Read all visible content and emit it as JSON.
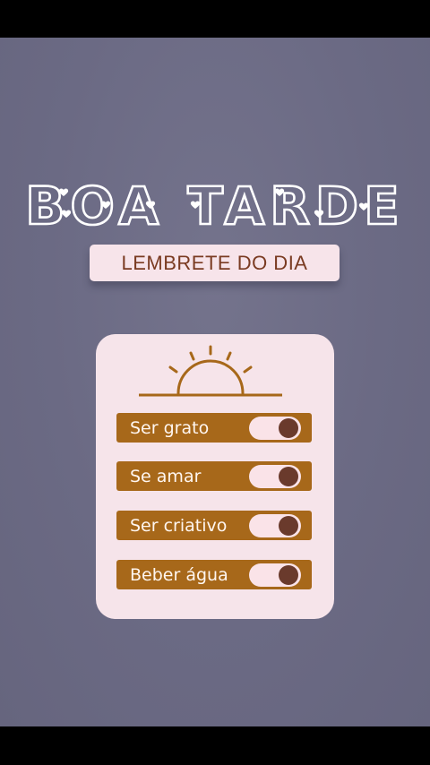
{
  "header": {
    "title": "BOA TARDE",
    "subtitle": "LEMBRETE DO DIA"
  },
  "card": {
    "icon": "sun-icon",
    "items": [
      {
        "label": "Ser grato",
        "on": true
      },
      {
        "label": "Se amar",
        "on": true
      },
      {
        "label": "Ser criativo",
        "on": true
      },
      {
        "label": "Beber água",
        "on": true
      }
    ]
  },
  "colors": {
    "background": "#6b6a84",
    "card": "#f6e4ea",
    "row": "#a7681a",
    "knob": "#6a3a2c",
    "subtitle_text": "#7a3b22"
  }
}
